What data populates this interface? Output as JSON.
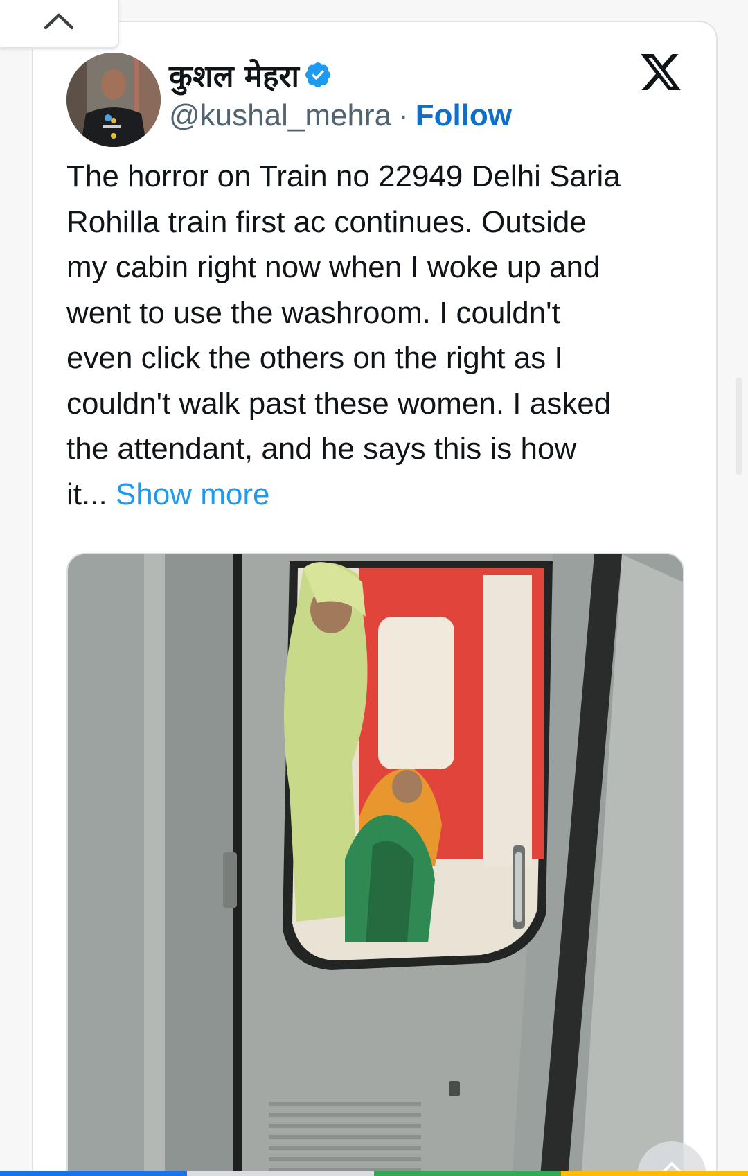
{
  "tweet": {
    "display_name": "कुशल मेहरा",
    "handle": "@kushal_mehra",
    "separator": "·",
    "follow_label": "Follow",
    "text": "The horror on Train no 22949 Delhi Saria\nRohilla train first ac continues. Outside\nmy cabin right now when I woke up and\nwent to use the washroom. I couldn't\neven click the others on the right as I\ncouldn't walk past these women. I asked\nthe attendant, and he says this is how\nit... ",
    "show_more_label": "Show more",
    "verified": true
  },
  "icons": {
    "collapse": "chevron-up-icon",
    "verified": "verified-badge-icon",
    "platform": "x-logo-icon",
    "scroll": "scroll-up-icon"
  },
  "colors": {
    "follow": "#0f6fc9",
    "show_more": "#1d9bf0",
    "verified": "#1d9bf0",
    "text": "#0f1419",
    "handle": "#536471"
  }
}
